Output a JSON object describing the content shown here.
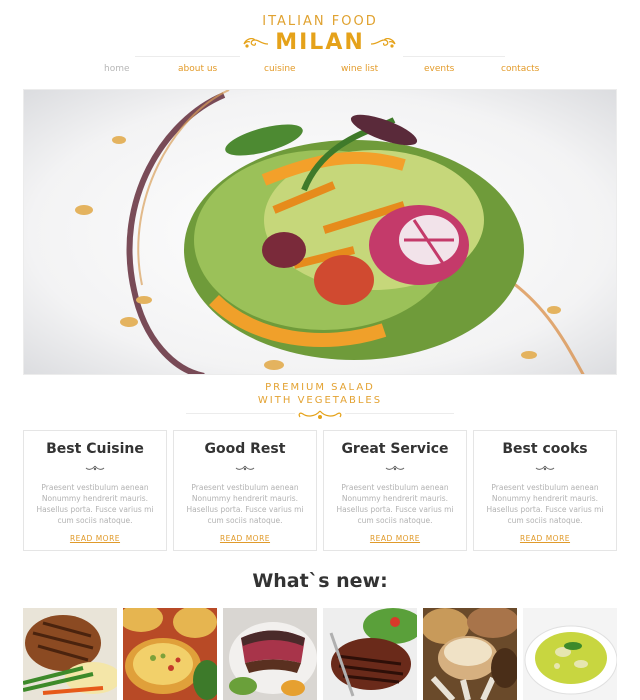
{
  "header": {
    "subtitle": "ITALIAN FOOD",
    "brand": "MILAN"
  },
  "nav": [
    {
      "label": "home",
      "active": false
    },
    {
      "label": "about us",
      "active": true
    },
    {
      "label": "cuisine",
      "active": true
    },
    {
      "label": "wine list",
      "active": true
    },
    {
      "label": "events",
      "active": true
    },
    {
      "label": "contacts",
      "active": true
    }
  ],
  "hero": {
    "caption_line1": "PREMIUM SALAD",
    "caption_line2": "WITH VEGETABLES"
  },
  "features": [
    {
      "title": "Best Cuisine",
      "text": "Praesent vestibulum aenean Nonummy hendrerit mauris. Hasellus porta. Fusce varius mi cum sociis natoque.",
      "link": "READ MORE"
    },
    {
      "title": "Good Rest",
      "text": "Praesent vestibulum aenean Nonummy hendrerit mauris. Hasellus porta. Fusce varius mi cum sociis natoque.",
      "link": "READ MORE"
    },
    {
      "title": "Great Service",
      "text": "Praesent vestibulum aenean Nonummy hendrerit mauris. Hasellus porta. Fusce varius mi cum sociis natoque.",
      "link": "READ MORE"
    },
    {
      "title": "Best cooks",
      "text": "Praesent vestibulum aenean Nonummy hendrerit mauris. Hasellus porta. Fusce varius mi cum sociis natoque.",
      "link": "READ MORE"
    }
  ],
  "whats_new": {
    "title": "What`s new:"
  },
  "thumbnails": [
    {
      "icon": "grilled-chicken-icon"
    },
    {
      "icon": "quiche-icon"
    },
    {
      "icon": "seared-tuna-icon"
    },
    {
      "icon": "steak-icon"
    },
    {
      "icon": "muffins-icon"
    },
    {
      "icon": "soup-icon"
    }
  ],
  "colors": {
    "accent": "#e5a21a",
    "text": "#333333",
    "muted": "#b2b2b2"
  }
}
